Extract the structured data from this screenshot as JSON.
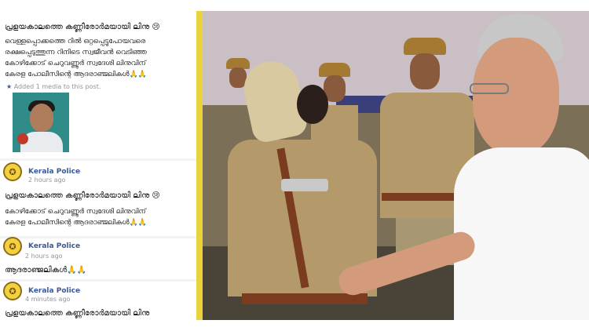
{
  "feed": {
    "posts": [
      {
        "line1": "പ്രളയകാലത്തെ കണ്ണീരോർമയായി ലിനു 😢",
        "line2": "വെള്ളപ്പൊക്കത്തെ റിൽ ഒറ്റപ്പെട്ടുപോയവരെ",
        "line3": "രക്ഷപ്പെടുത്തുന്ന റിനിടെ സ്വജീവൻ വെടിഞ്ഞ",
        "line4": "കോഴിക്കോട് ചെറുവണ്ണൂർ സ്വദേശി ലിനുവിന്",
        "line5": "കേരള പോലീസിന്റെ ആദരാഞ്ജലികൾ🙏🙏",
        "media_note": "Added 1 media to this post."
      },
      {
        "author": "Kerala Police",
        "time": "2 hours ago",
        "line1": "പ്രളയകാലത്തെ കണ്ണീരോർമയായി ലിനു 😢",
        "line2": "കോഴിക്കോട് ചെറുവണ്ണൂർ സ്വദേശി ലിനുവിന്",
        "line3": "കേരള പോലീസിന്റെ ആദരാഞ്ജലികൾ🙏🙏"
      },
      {
        "author": "Kerala Police",
        "time": "2 hours ago",
        "line1": "ആദരാഞ്ജലികൾ🙏🙏"
      },
      {
        "author": "Kerala Police",
        "time": "4 minutes ago",
        "line1": "പ്രളയകാലത്തെ കണ്ണീരോർമയായി ലിനു"
      }
    ]
  },
  "colors": {
    "author_link": "#385898",
    "divider": "#e9d23a",
    "khaki": "#b49a6a"
  },
  "icons": {
    "police_logo": "kerala-police-emblem-icon"
  }
}
